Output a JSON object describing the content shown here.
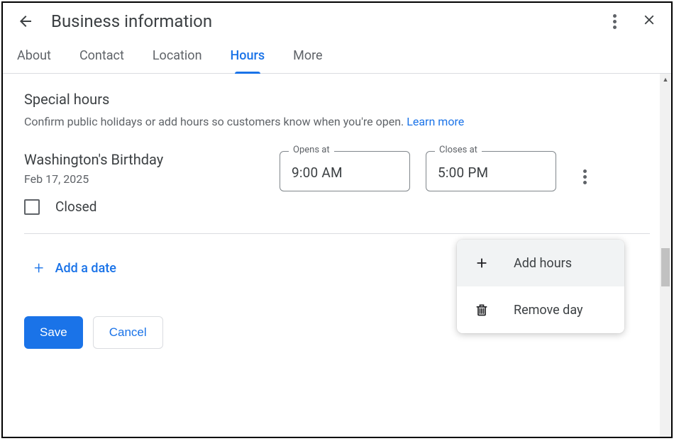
{
  "header": {
    "title": "Business information"
  },
  "tabs": [
    {
      "label": "About",
      "active": false
    },
    {
      "label": "Contact",
      "active": false
    },
    {
      "label": "Location",
      "active": false
    },
    {
      "label": "Hours",
      "active": true
    },
    {
      "label": "More",
      "active": false
    }
  ],
  "section": {
    "title": "Special hours",
    "description": "Confirm public holidays or add hours so customers know when you're open. ",
    "learn_more": "Learn more"
  },
  "holiday": {
    "name": "Washington's Birthday",
    "date": "Feb 17, 2025",
    "closed_label": "Closed",
    "opens_at_label": "Opens at",
    "opens_at_value": "9:00 AM",
    "closes_at_label": "Closes at",
    "closes_at_value": "5:00 PM"
  },
  "add_date_label": "Add a date",
  "buttons": {
    "save": "Save",
    "cancel": "Cancel"
  },
  "popup": {
    "add_hours": "Add hours",
    "remove_day": "Remove day"
  }
}
